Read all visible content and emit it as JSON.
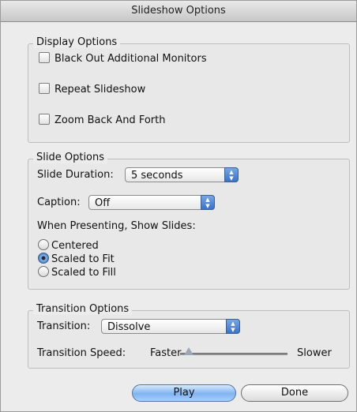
{
  "window": {
    "title": "Slideshow Options"
  },
  "display_options": {
    "title": "Display Options",
    "checkboxes": [
      {
        "label": "Black Out Additional Monitors",
        "checked": false
      },
      {
        "label": "Repeat Slideshow",
        "checked": false
      },
      {
        "label": "Zoom Back And Forth",
        "checked": false
      }
    ]
  },
  "slide_options": {
    "title": "Slide Options",
    "duration_label": "Slide Duration:",
    "duration_value": "5 seconds",
    "caption_label": "Caption:",
    "caption_value": "Off",
    "presenting_label": "When Presenting, Show Slides:",
    "radios": [
      {
        "label": "Centered",
        "selected": false
      },
      {
        "label": "Scaled to Fit",
        "selected": true
      },
      {
        "label": "Scaled to Fill",
        "selected": false
      }
    ]
  },
  "transition_options": {
    "title": "Transition Options",
    "transition_label": "Transition:",
    "transition_value": "Dissolve",
    "speed_label": "Transition Speed:",
    "speed_min_label": "Faster",
    "speed_max_label": "Slower",
    "speed_value": 0.08
  },
  "buttons": {
    "play": "Play",
    "done": "Done"
  },
  "icons": {
    "popup_arrows": "up-down-arrows-icon",
    "slider_knob": "slider-knob-icon"
  }
}
